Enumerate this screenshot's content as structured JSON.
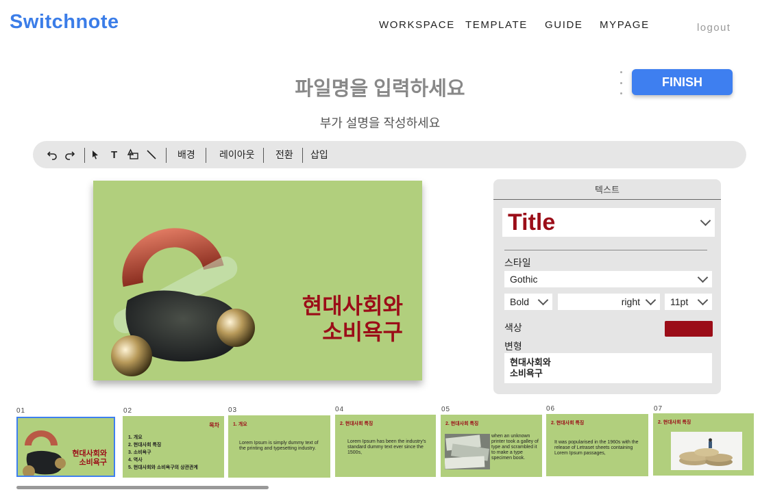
{
  "header": {
    "logo": "Switchnote",
    "nav": [
      "WORKSPACE",
      "TEMPLATE",
      "GUIDE",
      "MYPAGE"
    ],
    "logout": "logout"
  },
  "document": {
    "title_placeholder": "파일명을 입력하세요",
    "subtitle_placeholder": "부가 설명을 작성하세요",
    "finish_label": "FINISH"
  },
  "toolbar": {
    "icons": [
      "undo-icon",
      "redo-icon",
      "pointer-icon",
      "text-icon",
      "shape-icon",
      "line-icon"
    ],
    "text_glyph": "T",
    "menus": [
      "배경",
      "레이아웃",
      "전환",
      "삽입"
    ]
  },
  "slide": {
    "title": "현대사회와\n소비욕구",
    "background": "#b1cf7d",
    "title_color": "#9b0d18"
  },
  "panel": {
    "tab": "텍스트",
    "preset": "Title",
    "style_label": "스타일",
    "font": "Gothic",
    "weight": "Bold",
    "align": "right",
    "size": "11pt",
    "color_label": "색상",
    "color_value": "#9b0d18",
    "transform_label": "변형",
    "text_value": "현대사회와\n소비욕구"
  },
  "thumbnails": [
    {
      "num": "01",
      "title": "현대사회와\n소비욕구"
    },
    {
      "num": "02",
      "heading": "목차",
      "items": [
        "1. 개요",
        "2. 현대사회 특징",
        "3. 소비욕구",
        "4. 역사",
        "5. 현대사회와 소비욕구의 상관관계"
      ]
    },
    {
      "num": "03",
      "heading": "1. 개요",
      "body": "Lorem Ipsum is simply dummy text of the printing and typesetting industry."
    },
    {
      "num": "04",
      "heading": "2. 현대사회 특징",
      "body": "Lorem Ipsum has been the industry's standard dummy text ever since the 1500s,"
    },
    {
      "num": "05",
      "heading": "2. 현대사회 특징",
      "body": "when an unknown printer took a galley of type and scrambled it to make a type specimen book."
    },
    {
      "num": "06",
      "heading": "2. 현대사회 특징",
      "body": "It was popularised in the 1960s with the release of Letraset sheets containing Lorem Ipsum passages,"
    },
    {
      "num": "07",
      "heading": "2. 현대사회 특징"
    }
  ]
}
